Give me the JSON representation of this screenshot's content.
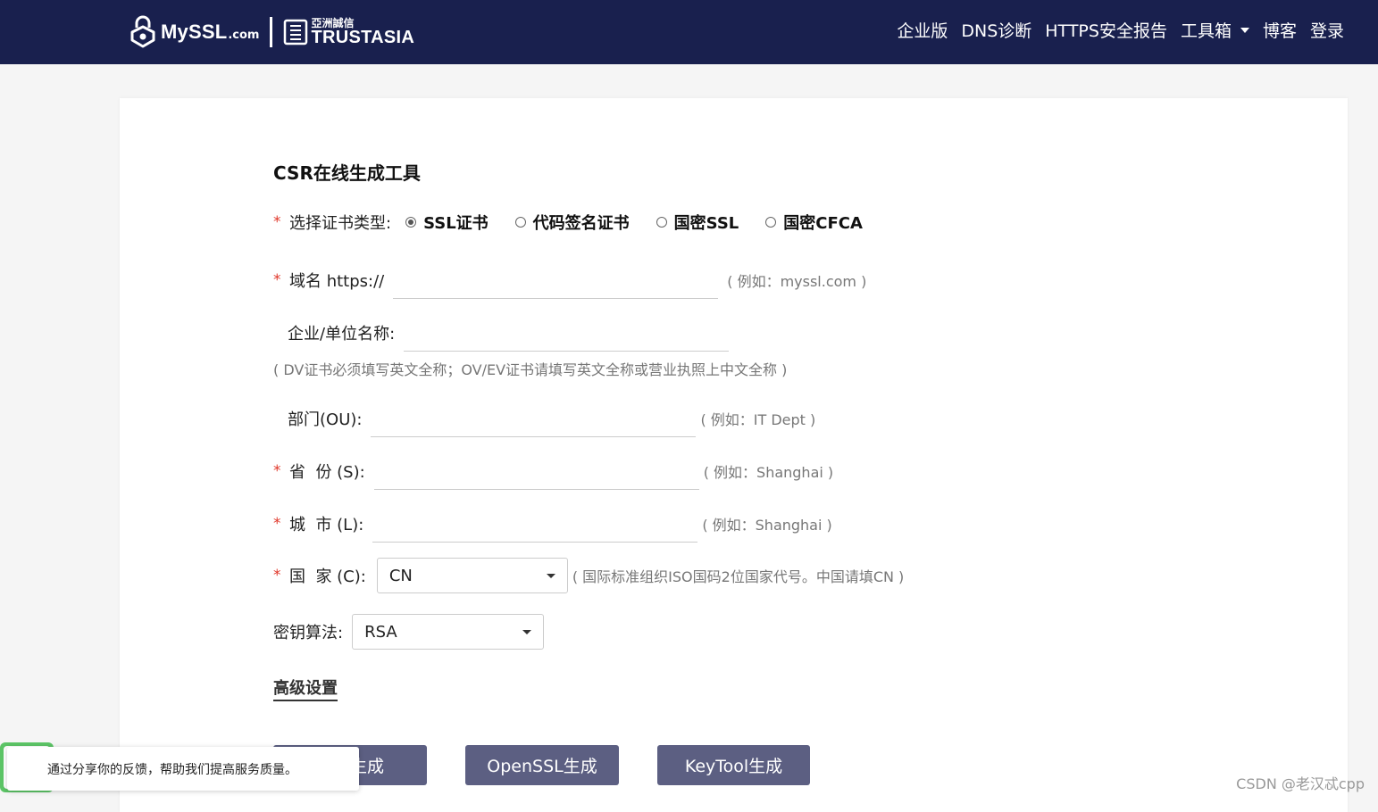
{
  "header": {
    "brand": "MySSL",
    "brand_domain": ".com",
    "partner_cn": "亞洲誠信",
    "partner_en": "TRUSTASIA",
    "nav": [
      "企业版",
      "DNS诊断",
      "HTTPS安全报告",
      "工具箱",
      "博客",
      "登录"
    ],
    "bg_color": "#19204e"
  },
  "form": {
    "title": "CSR在线生成工具",
    "required_mark": "*",
    "cert_type": {
      "label": "选择证书类型:",
      "options": [
        "SSL证书",
        "代码签名证书",
        "国密SSL",
        "国密CFCA"
      ],
      "selected": "SSL证书"
    },
    "domain": {
      "label": "域名 https://",
      "value": "",
      "hint": "( 例如：myssl.com )"
    },
    "org": {
      "label": "企业/单位名称:",
      "value": "",
      "hint": "( DV证书必须填写英文全称；OV/EV证书请填写英文全称或营业执照上中文全称 )"
    },
    "ou": {
      "label": "部门(OU):",
      "value": "",
      "hint": "( 例如：IT Dept )"
    },
    "state": {
      "label": "省  份 (S):",
      "value": "",
      "hint": "( 例如：Shanghai )"
    },
    "city": {
      "label": "城  市 (L):",
      "value": "",
      "hint": "( 例如：Shanghai )"
    },
    "country": {
      "label": "国  家 (C):",
      "value": "CN",
      "hint": "( 国际标准组织ISO国码2位国家代号。中国请填CN )"
    },
    "key_algo": {
      "label": "密钥算法:",
      "value": "RSA"
    },
    "advanced_link": "高级设置",
    "buttons": [
      "在线生成",
      "OpenSSL生成",
      "KeyTool生成"
    ],
    "button_color": "#5c5f82"
  },
  "feedback": {
    "text": "通过分享你的反馈，帮助我们提高服务质量。"
  },
  "watermark": "CSDN @老汉忒cpp"
}
